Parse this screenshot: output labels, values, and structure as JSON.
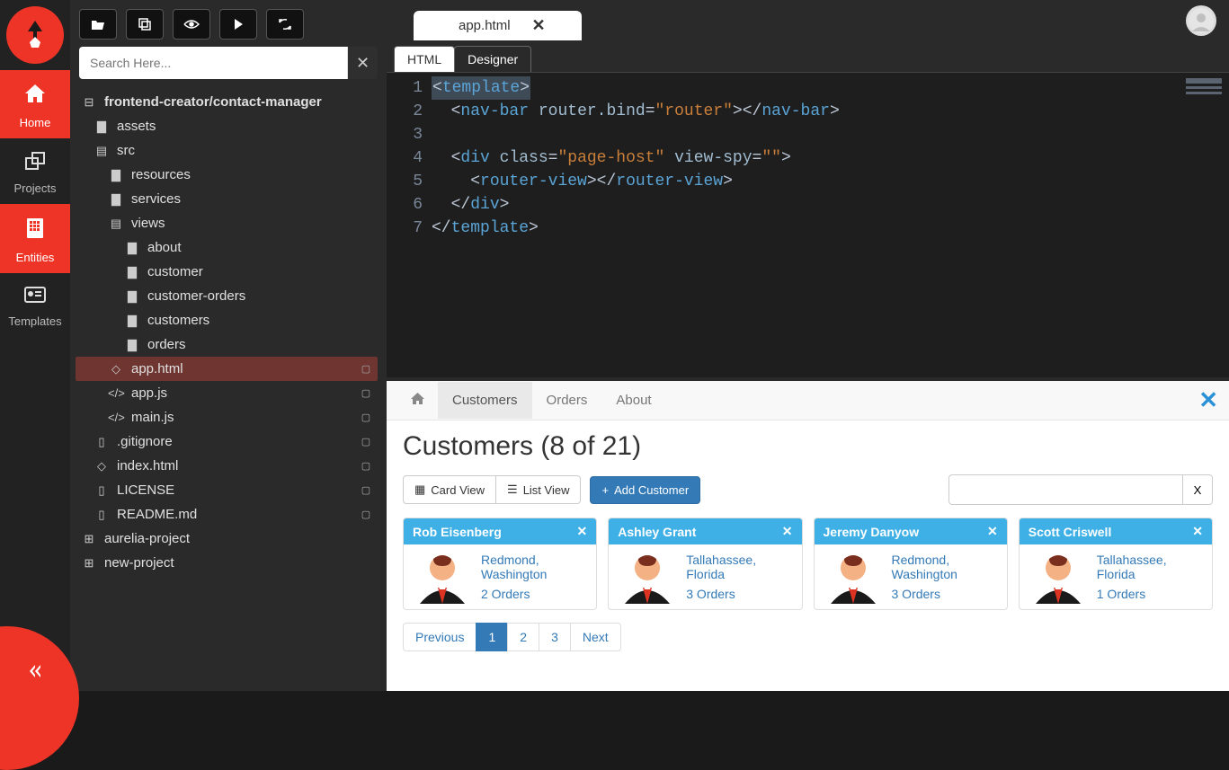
{
  "leftnav": {
    "items": [
      {
        "label": "Home"
      },
      {
        "label": "Projects"
      },
      {
        "label": "Entities"
      },
      {
        "label": "Templates"
      }
    ]
  },
  "toolbar": {
    "search_placeholder": "Search Here..."
  },
  "tree": {
    "root": "frontend-creator/contact-manager",
    "nodes": {
      "assets": "assets",
      "src": "src",
      "resources": "resources",
      "services": "services",
      "views": "views",
      "about": "about",
      "customer": "customer",
      "customer_orders": "customer-orders",
      "customers": "customers",
      "orders": "orders",
      "app_html": "app.html",
      "app_js": "app.js",
      "main_js": "main.js",
      "gitignore": ".gitignore",
      "index_html": "index.html",
      "license": "LICENSE",
      "readme": "README.md",
      "aurelia_project": "aurelia-project",
      "new_project": "new-project"
    }
  },
  "tab": {
    "name": "app.html"
  },
  "subtabs": {
    "html": "HTML",
    "designer": "Designer"
  },
  "editor": {
    "lines": [
      "1",
      "2",
      "3",
      "4",
      "5",
      "6",
      "7"
    ],
    "l1_tag": "template",
    "l2_tag": "nav-bar",
    "l2_attr": "router.bind",
    "l2_val": "\"router\"",
    "l4_tag": "div",
    "l4_attr1": "class",
    "l4_val1": "\"page-host\"",
    "l4_attr2": "view-spy",
    "l4_val2": "\"\"",
    "l5_tag": "router-view",
    "l6_tag": "div",
    "l7_tag": "template"
  },
  "preview": {
    "nav": {
      "customers": "Customers",
      "orders": "Orders",
      "about": "About"
    },
    "heading": "Customers (8 of 21)",
    "card_view": "Card View",
    "list_view": "List View",
    "add_customer": "Add Customer",
    "search_btn": "X",
    "cards": [
      {
        "name": "Rob Eisenberg",
        "city": "Redmond,",
        "state": "Washington",
        "orders": "2 Orders"
      },
      {
        "name": "Ashley Grant",
        "city": "Tallahassee,",
        "state": "Florida",
        "orders": "3 Orders"
      },
      {
        "name": "Jeremy Danyow",
        "city": "Redmond,",
        "state": "Washington",
        "orders": "3 Orders"
      },
      {
        "name": "Scott Criswell",
        "city": "Tallahassee,",
        "state": "Florida",
        "orders": "1 Orders"
      }
    ],
    "pager": {
      "prev": "Previous",
      "p1": "1",
      "p2": "2",
      "p3": "3",
      "next": "Next"
    }
  }
}
